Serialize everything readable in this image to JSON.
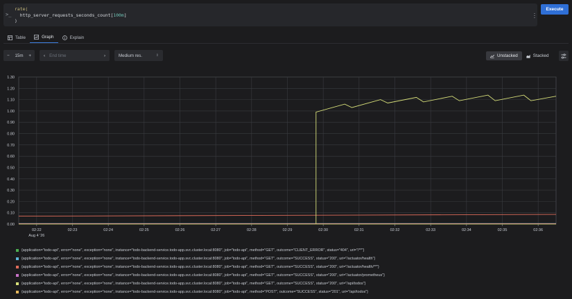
{
  "editor": {
    "prompt_icon": ">_",
    "code_line1_fn": "rate(",
    "code_line2_metric": "  http_server_requests_seconds_count[",
    "code_line2_range": "100m",
    "code_line2_close": "]",
    "code_line3": ")",
    "execute_label": "Execute",
    "menu_icon": "kebab-menu-icon"
  },
  "tabs": [
    {
      "label": "Table",
      "icon": "table-icon",
      "active": false
    },
    {
      "label": "Graph",
      "icon": "graph-icon",
      "active": true
    },
    {
      "label": "Explain",
      "icon": "info-icon",
      "active": false
    }
  ],
  "controls": {
    "range_value": "15m",
    "range_decrement": "−",
    "range_increment": "+",
    "end_time_placeholder": "End time",
    "resolution": "Medium res.",
    "unstacked_label": "Unstacked",
    "stacked_label": "Stacked"
  },
  "chart_data": {
    "type": "line",
    "y_ticks": [
      "0.00",
      "0.10",
      "0.20",
      "0.30",
      "0.40",
      "0.50",
      "0.60",
      "0.70",
      "0.80",
      "0.90",
      "1.00",
      "1.10",
      "1.20",
      "1.30"
    ],
    "ylim": [
      0,
      1.3
    ],
    "x_ticks": [
      "02:22",
      "02:23",
      "02:24",
      "02:25",
      "02:26",
      "02:27",
      "02:28",
      "02:29",
      "02:30",
      "02:31",
      "02:32",
      "02:33",
      "02:34",
      "02:35",
      "02:36"
    ],
    "x_date_label": "Aug 4 '26",
    "xlim": [
      -0.5,
      14.5
    ],
    "grid": true,
    "series": [
      {
        "name": "{application=\"todo-api\", error=\"none\", exception=\"none\", instance=\"todo-backend-service.todo-app.svc.cluster.local:8080\", job=\"todo-api\", method=\"GET\", outcome=\"CLIENT_ERROR\", status=\"404\", uri=\"/**\"}",
        "color": "#4caf50",
        "x": [
          -0.5,
          14.5
        ],
        "y": [
          0,
          0
        ]
      },
      {
        "name": "{application=\"todo-api\", error=\"none\", exception=\"none\", instance=\"todo-backend-service.todo-app.svc.cluster.local:8080\", job=\"todo-api\", method=\"GET\", outcome=\"SUCCESS\", status=\"200\", uri=\"/actuator/health\"}",
        "color": "#5fb6d9",
        "x": [
          -0.5,
          14.5
        ],
        "y": [
          0.005,
          0.005
        ]
      },
      {
        "name": "{application=\"todo-api\", error=\"none\", exception=\"none\", instance=\"todo-backend-service.todo-app.svc.cluster.local:8080\", job=\"todo-api\", method=\"GET\", outcome=\"SUCCESS\", status=\"200\", uri=\"/actuator/health/**\"}",
        "color": "#e06c5a",
        "x": [
          -0.5,
          14.5
        ],
        "y": [
          0.07,
          0.085
        ]
      },
      {
        "name": "{application=\"todo-api\", error=\"none\", exception=\"none\", instance=\"todo-backend-service.todo-app.svc.cluster.local:8080\", job=\"todo-api\", method=\"GET\", outcome=\"SUCCESS\", status=\"200\", uri=\"/actuator/prometheus\"}",
        "color": "#c973c9",
        "x": [
          -0.5,
          14.5
        ],
        "y": [
          0.003,
          0.003
        ]
      },
      {
        "name": "{application=\"todo-api\", error=\"none\", exception=\"none\", instance=\"todo-backend-service.todo-app.svc.cluster.local:8080\", job=\"todo-api\", method=\"GET\", outcome=\"SUCCESS\", status=\"200\", uri=\"/api/todos\"}",
        "color": "#d8e07a",
        "x": [
          7.8,
          7.8,
          8.6,
          8.8,
          9.6,
          9.8,
          10.6,
          10.8,
          11.6,
          11.8,
          12.6,
          12.8,
          13.6,
          13.8,
          14.5
        ],
        "y": [
          0,
          0.99,
          1.06,
          1.03,
          1.1,
          1.07,
          1.12,
          1.08,
          1.13,
          1.09,
          1.14,
          1.09,
          1.14,
          1.09,
          1.13
        ]
      },
      {
        "name": "{application=\"todo-api\", error=\"none\", exception=\"none\", instance=\"todo-backend-service.todo-app.svc.cluster.local:8080\", job=\"todo-api\", method=\"POST\", outcome=\"SUCCESS\", status=\"201\", uri=\"/api/todos\"}",
        "color": "#e6b85c",
        "x": [
          -0.5,
          14.5
        ],
        "y": [
          0.001,
          0.001
        ]
      }
    ]
  }
}
